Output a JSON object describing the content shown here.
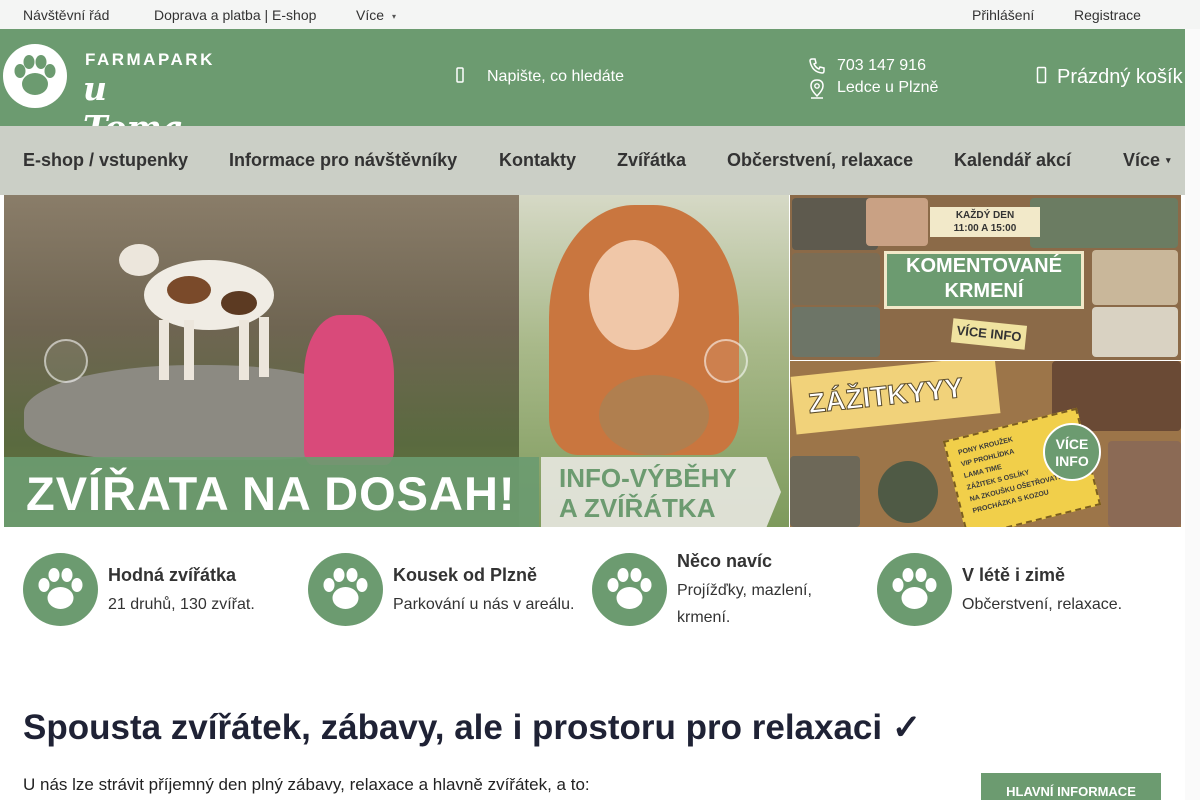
{
  "topbar": {
    "links": [
      "Návštěvní řád",
      "Doprava a platba | E-shop",
      "Více"
    ],
    "login": "Přihlášení",
    "register": "Registrace"
  },
  "header": {
    "logo": {
      "top": "FARMAPARK",
      "main": "u Toma"
    },
    "search_placeholder": "Napište, co hledáte",
    "phone": "703 147 916",
    "address": "Ledce u Plzně",
    "cart": "Prázdný košík"
  },
  "nav": {
    "items": [
      "E-shop / vstupenky",
      "Informace pro návštěvníky",
      "Kontakty",
      "Zvířátka",
      "Občerstvení, relaxace",
      "Kalendář akcí",
      "Více"
    ]
  },
  "banner": {
    "headline": "ZVÍŘATA NA DOSAH!",
    "side_line1": "INFO-VÝBĚHY",
    "side_line2": "A ZVÍŘÁTKA"
  },
  "promos": {
    "feeding": {
      "time_line1": "KAŽDÝ DEN",
      "time_line2": "11:00 A 15:00",
      "title_line1": "KOMENTOVANÉ",
      "title_line2": "KRMENÍ",
      "more": "VÍCE INFO"
    },
    "experiences": {
      "title": "ZÁŽITKYYY",
      "list": [
        "PONY KROUŽEK",
        "VIP PROHLÍDKA",
        "LAMA TIME",
        "ZÁŽITEK S OSLÍKY",
        "NA ZKOUŠKU OŠETŘOVATELEM",
        "PROCHÁZKA S KOZOU"
      ],
      "badge_line1": "VÍCE",
      "badge_line2": "INFO"
    }
  },
  "features": [
    {
      "title": "Hodná zvířátka",
      "subtitle": "21 druhů, 130 zvířat."
    },
    {
      "title": "Kousek od Plzně",
      "subtitle": "Parkování u nás v areálu."
    },
    {
      "title": "Něco navíc",
      "subtitle": "Projížďky, mazlení, krmení."
    },
    {
      "title": "V létě i zimě",
      "subtitle": "Občerstvení, relaxace."
    }
  ],
  "main": {
    "heading": "Spousta zvířátek, zábavy, ale i prostoru pro relaxaci ✓",
    "intro": "U nás lze strávit příjemný den plný zábavy, relaxace a hlavně zvířátek, a to:",
    "info_button": "HLAVNÍ INFORMACE"
  },
  "colors": {
    "brand_green": "#6c9b70",
    "nav_bg": "#cbcfc6",
    "heading": "#1f2235"
  }
}
